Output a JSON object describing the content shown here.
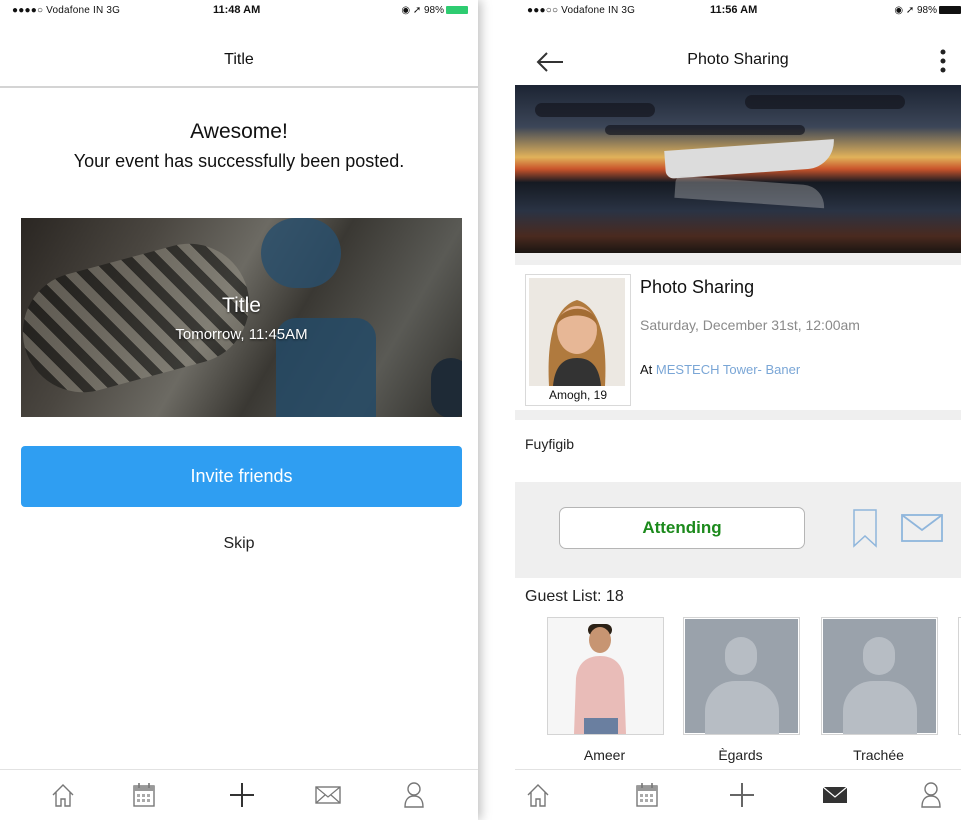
{
  "left_screen": {
    "status_bar": {
      "carrier": "●●●●○ Vodafone IN  3G",
      "time": "11:48 AM",
      "battery": "◉ ➚ 98%"
    },
    "nav_title": "Title",
    "heading": "Awesome!",
    "subheading": "Your event has successfully been posted.",
    "card": {
      "title": "Title",
      "datetime": "Tomorrow, 11:45AM"
    },
    "invite_label": "Invite friends",
    "skip_label": "Skip",
    "tabs": [
      "home-icon",
      "calendar-icon",
      "plus-icon",
      "mail-icon",
      "profile-icon"
    ]
  },
  "right_screen": {
    "status_bar": {
      "carrier": "●●●○○ Vodafone IN  3G",
      "time": "11:56 AM",
      "battery": "◉ ➚ 98%"
    },
    "nav_title": "Photo Sharing",
    "event": {
      "title": "Photo Sharing",
      "date": "Saturday, December 31st, 12:00am",
      "location_prefix": "At",
      "location": "MESTECH Tower- Baner",
      "host": "Amogh, 19"
    },
    "description": "Fuyfigib",
    "attend_label": "Attending",
    "guest_list_label": "Guest List: 18",
    "guests": [
      {
        "name": "Ameer"
      },
      {
        "name": "Ègards"
      },
      {
        "name": "Trachée"
      }
    ],
    "tabs": [
      "home-icon",
      "calendar-icon",
      "plus-icon",
      "mail-icon",
      "profile-icon"
    ]
  },
  "colors": {
    "accent_blue": "#2f9ef2",
    "attending_green": "#1c8a1c",
    "battery_green": "#2ecc71",
    "link_blue": "#7aa6d6"
  }
}
